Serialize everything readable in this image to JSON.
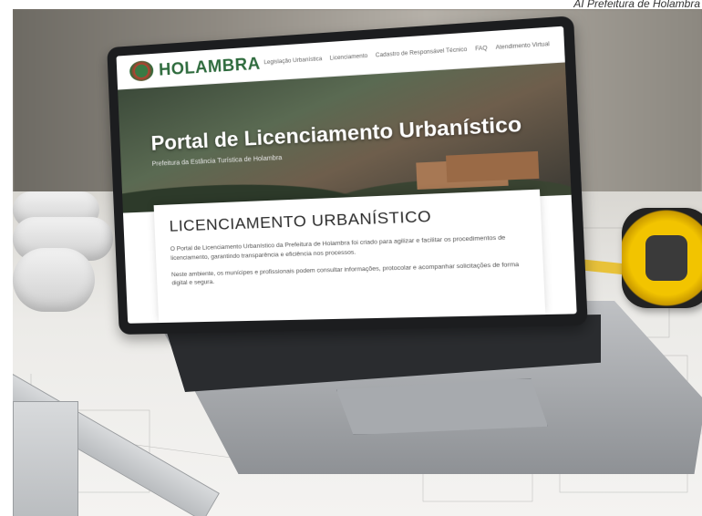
{
  "caption": "AI Prefeitura de Holambra",
  "screen": {
    "logo_text": "HOLAMBRA",
    "nav_links": [
      "Legislação Urbanística",
      "Licenciamento",
      "Cadastro de Responsável Técnico",
      "FAQ",
      "Atendimento Virtual"
    ],
    "hero_title": "Portal de Licenciamento Urbanístico",
    "hero_subtitle": "Prefeitura da Estância Turística de Holambra",
    "card_heading": "LICENCIAMENTO URBANÍSTICO",
    "card_paragraphs": [
      "O Portal de Licenciamento Urbanístico da Prefeitura de Holambra foi criado para agilizar e facilitar os procedimentos de licenciamento, garantindo transparência e eficiência nos processos.",
      "Neste ambiente, os munícipes e profissionais podem consultar informações, protocolar e acompanhar solicitações de forma digital e segura."
    ]
  },
  "scene": {
    "objects": [
      "blueprint-rolls",
      "ruler",
      "tape-measure",
      "pencil",
      "laptop"
    ]
  }
}
